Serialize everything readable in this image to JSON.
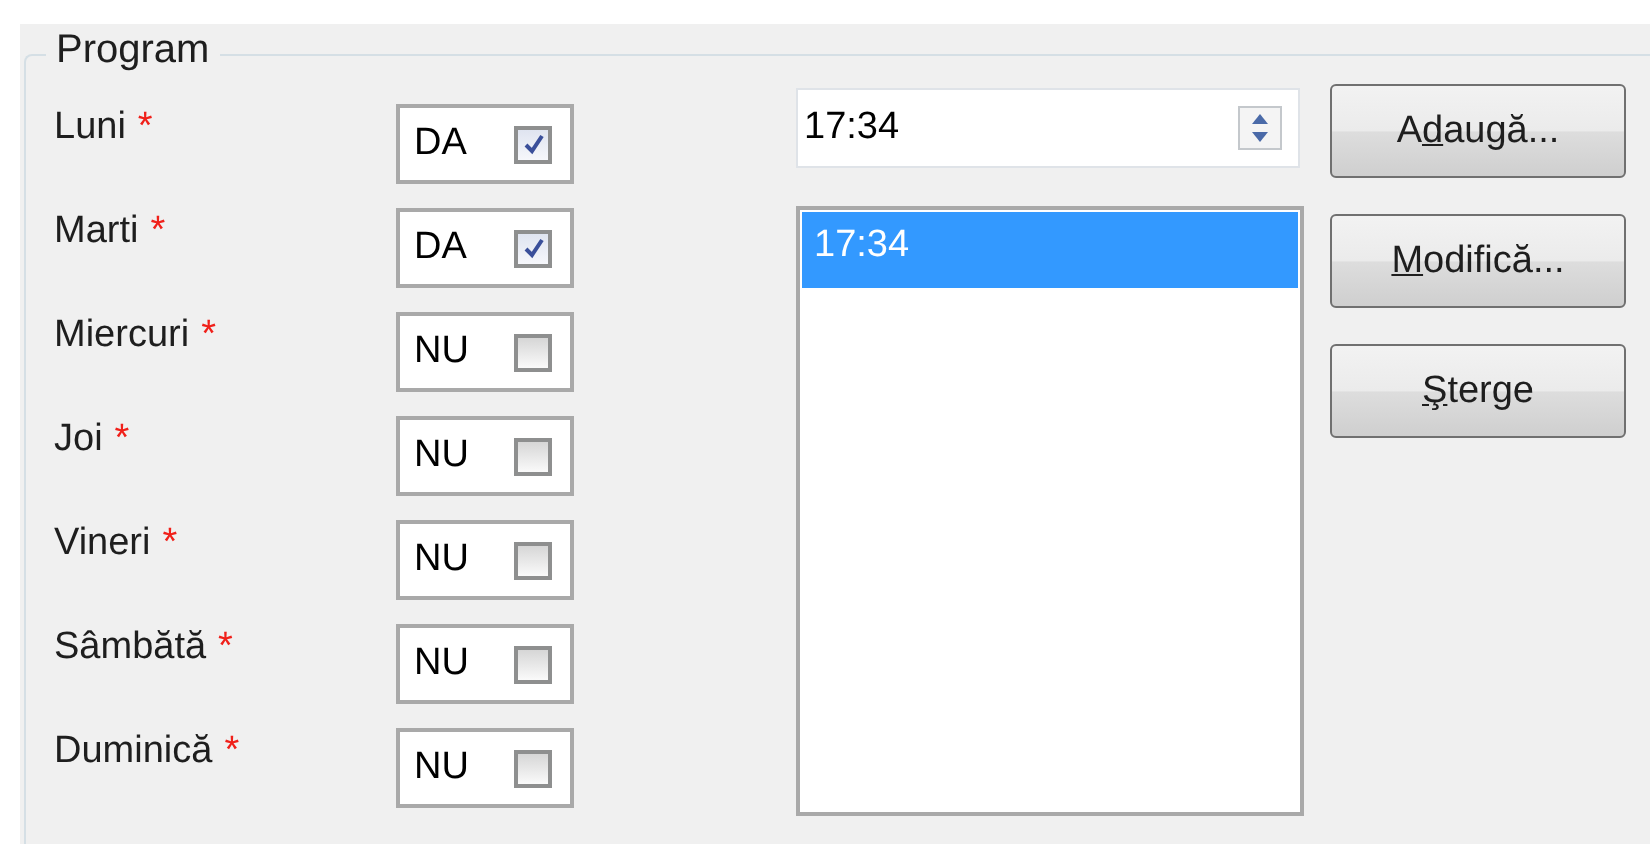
{
  "group": {
    "title": "Program"
  },
  "days": [
    {
      "label": "Luni",
      "required_mark": "*",
      "value_text": "DA",
      "checked": true
    },
    {
      "label": "Marti",
      "required_mark": "*",
      "value_text": "DA",
      "checked": true
    },
    {
      "label": "Miercuri",
      "required_mark": "*",
      "value_text": "NU",
      "checked": false
    },
    {
      "label": "Joi",
      "required_mark": "*",
      "value_text": "NU",
      "checked": false
    },
    {
      "label": "Vineri",
      "required_mark": "*",
      "value_text": "NU",
      "checked": false
    },
    {
      "label": "Sâmbătă",
      "required_mark": "*",
      "value_text": "NU",
      "checked": false
    },
    {
      "label": "Duminică",
      "required_mark": "*",
      "value_text": "NU",
      "checked": false
    }
  ],
  "time_field": {
    "value": "17:34"
  },
  "time_list": [
    {
      "text": "17:34",
      "selected": true
    }
  ],
  "buttons": [
    {
      "label_before": "A",
      "mnemonic": "d",
      "label_after": "augă..."
    },
    {
      "mnemonic": "M",
      "label_after": "odifică..."
    },
    {
      "mnemonic": "Ş",
      "label_after": "terge"
    }
  ]
}
